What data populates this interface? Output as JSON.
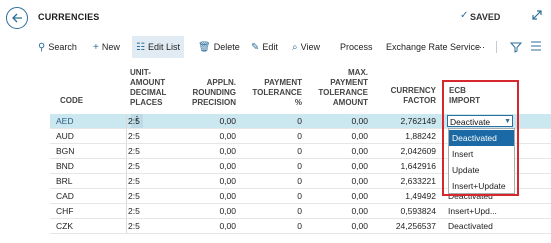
{
  "page_title": "CURRENCIES",
  "status": "SAVED",
  "actions": {
    "search": "Search",
    "new": "New",
    "edit_list": "Edit List",
    "delete": "Delete",
    "edit": "Edit",
    "view": "View",
    "process": "Process",
    "exchange_rate_service": "Exchange Rate Service",
    "more": "···"
  },
  "columns": {
    "code": "CODE",
    "unit_amount": [
      "UNIT-",
      "AMOUNT",
      "DECIMAL",
      "PLACES"
    ],
    "appln_rounding": [
      "APPLN.",
      "ROUNDING",
      "PRECISION"
    ],
    "payment_tolerance": [
      "PAYMENT",
      "TOLERANCE",
      "%"
    ],
    "max_payment_tolerance": [
      "MAX.",
      "PAYMENT",
      "TOLERANCE",
      "AMOUNT"
    ],
    "currency_factor": [
      "CURRENCY",
      "FACTOR"
    ],
    "ecb_import": [
      "ECB",
      "IMPORT"
    ]
  },
  "rows": [
    {
      "code": "AED",
      "places": "2:5",
      "rounding": "0,00",
      "tolerance": "0",
      "max_tolerance": "0,00",
      "factor": "2,762149",
      "ecb": "Deactivate"
    },
    {
      "code": "AUD",
      "places": "2:5",
      "rounding": "0,00",
      "tolerance": "0",
      "max_tolerance": "0,00",
      "factor": "1,88242",
      "ecb": ""
    },
    {
      "code": "BGN",
      "places": "2:5",
      "rounding": "0,00",
      "tolerance": "0",
      "max_tolerance": "0,00",
      "factor": "2,042609",
      "ecb": ""
    },
    {
      "code": "BND",
      "places": "2:5",
      "rounding": "0,00",
      "tolerance": "0",
      "max_tolerance": "0,00",
      "factor": "1,642916",
      "ecb": ""
    },
    {
      "code": "BRL",
      "places": "2:5",
      "rounding": "0,00",
      "tolerance": "0",
      "max_tolerance": "0,00",
      "factor": "2,633221",
      "ecb": ""
    },
    {
      "code": "CAD",
      "places": "2:5",
      "rounding": "0,00",
      "tolerance": "0",
      "max_tolerance": "0,00",
      "factor": "1,49492",
      "ecb": "Deactivated"
    },
    {
      "code": "CHF",
      "places": "2:5",
      "rounding": "0,00",
      "tolerance": "0",
      "max_tolerance": "0,00",
      "factor": "0,593824",
      "ecb": "Insert+Upd..."
    },
    {
      "code": "CZK",
      "places": "2:5",
      "rounding": "0,00",
      "tolerance": "0",
      "max_tolerance": "0,00",
      "factor": "24,256537",
      "ecb": "Deactivated"
    }
  ],
  "ecb_dropdown": {
    "current": "Deactivate",
    "options": [
      "Deactivated",
      "Insert",
      "Update",
      "Insert+Update"
    ],
    "highlighted": "Deactivated"
  },
  "colors": {
    "accent": "#2c6e99",
    "selected_row": "#cbe7f0",
    "highlight_frame": "#d6262e"
  }
}
